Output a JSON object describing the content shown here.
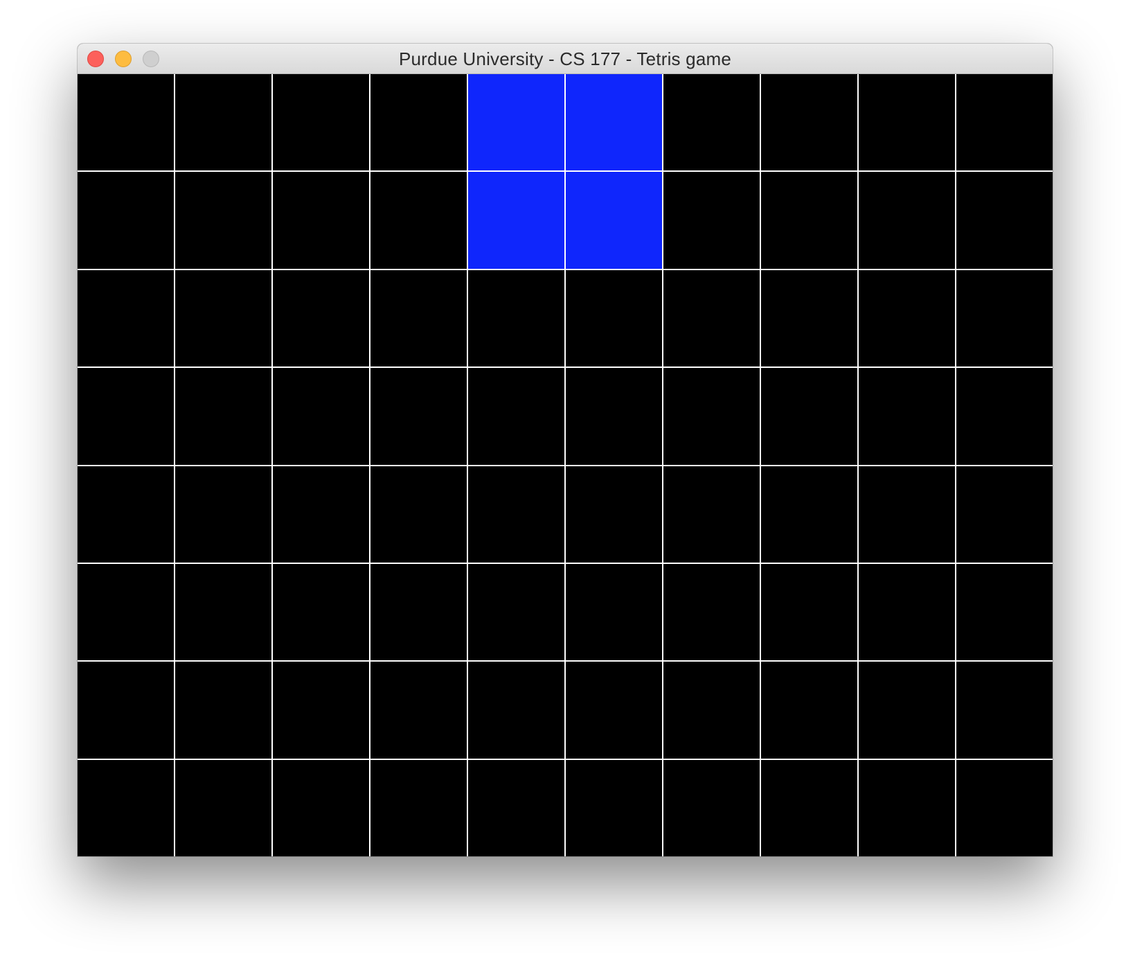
{
  "window": {
    "title": "Purdue University - CS 177 - Tetris game",
    "controls": [
      "close-icon",
      "minimize-icon",
      "zoom-icon"
    ]
  },
  "board": {
    "columns": 10,
    "rows": 8,
    "empty_color": "#000000",
    "grid_line_color": "#ffffff",
    "active_piece": {
      "shape": "O",
      "color": "#0f26fc",
      "cells": [
        [
          0,
          4
        ],
        [
          0,
          5
        ],
        [
          1,
          4
        ],
        [
          1,
          5
        ]
      ]
    }
  }
}
